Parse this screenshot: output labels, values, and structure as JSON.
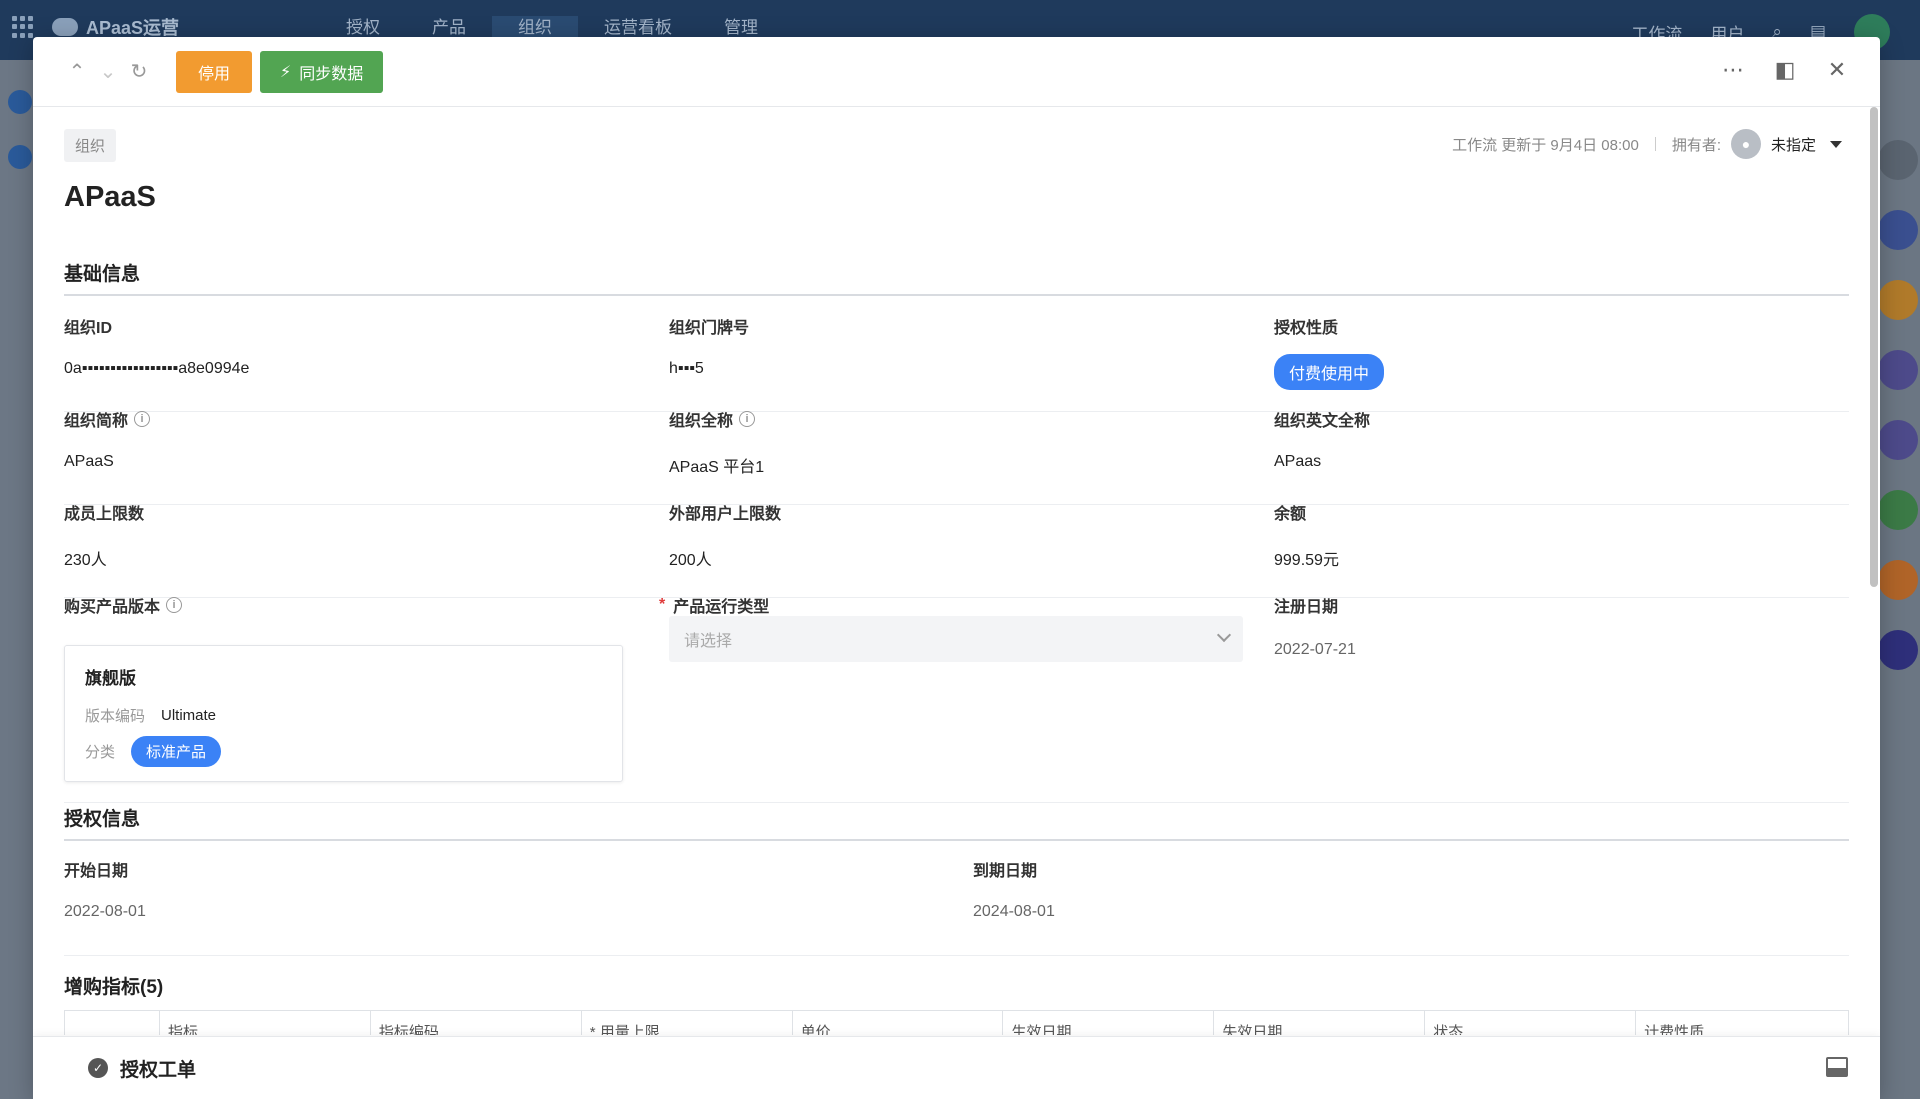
{
  "bg_app": {
    "brand": "APaaS运营",
    "nav": [
      "授权",
      "产品",
      "组织",
      "运营看板",
      "管理"
    ],
    "right": [
      "工作流",
      "用户"
    ]
  },
  "toolbar": {
    "disable_label": "停用",
    "sync_label": "同步数据"
  },
  "header": {
    "object_tag": "组织",
    "title": "APaaS",
    "workflow_meta": "工作流 更新于 9月4日 08:00",
    "owner_label": "拥有者:",
    "owner_value": "未指定"
  },
  "basic": {
    "section_title": "基础信息",
    "org_id_label": "组织ID",
    "org_id_value": "0a▪︎▪︎▪︎▪︎▪︎▪︎▪︎▪︎▪︎▪︎▪︎▪︎▪︎▪︎▪︎▪︎▪︎a8e0994e",
    "door_no_label": "组织门牌号",
    "door_no_value": "h▪︎▪︎▪︎5",
    "license_type_label": "授权性质",
    "license_type_value": "付费使用中",
    "short_name_label": "组织简称",
    "short_name_value": "APaaS",
    "full_name_label": "组织全称",
    "full_name_value": "APaaS 平台1",
    "en_name_label": "组织英文全称",
    "en_name_value": "APaas",
    "member_limit_label": "成员上限数",
    "member_limit_value": "230人",
    "external_limit_label": "外部用户上限数",
    "external_limit_value": "200人",
    "balance_label": "余额",
    "balance_value": "999.59元",
    "product_version_label": "购买产品版本",
    "run_type_label": "产品运行类型",
    "run_type_placeholder": "请选择",
    "register_date_label": "注册日期",
    "register_date_value": "2022-07-21"
  },
  "version_card": {
    "name": "旗舰版",
    "code_label": "版本编码",
    "code_value": "Ultimate",
    "category_label": "分类",
    "category_value": "标准产品"
  },
  "license": {
    "section_title": "授权信息",
    "start_label": "开始日期",
    "start_value": "2022-08-01",
    "end_label": "到期日期",
    "end_value": "2024-08-01"
  },
  "addon": {
    "section_title": "增购指标(5)",
    "columns": [
      "",
      "指标",
      "指标编码",
      "* 用量上限",
      "单价",
      "生效日期",
      "失效日期",
      "状态",
      "计费性质"
    ]
  },
  "footer": {
    "title": "授权工单"
  },
  "colors": {
    "orange": "#f29b30",
    "green": "#52a552",
    "blue": "#3b82f6"
  }
}
